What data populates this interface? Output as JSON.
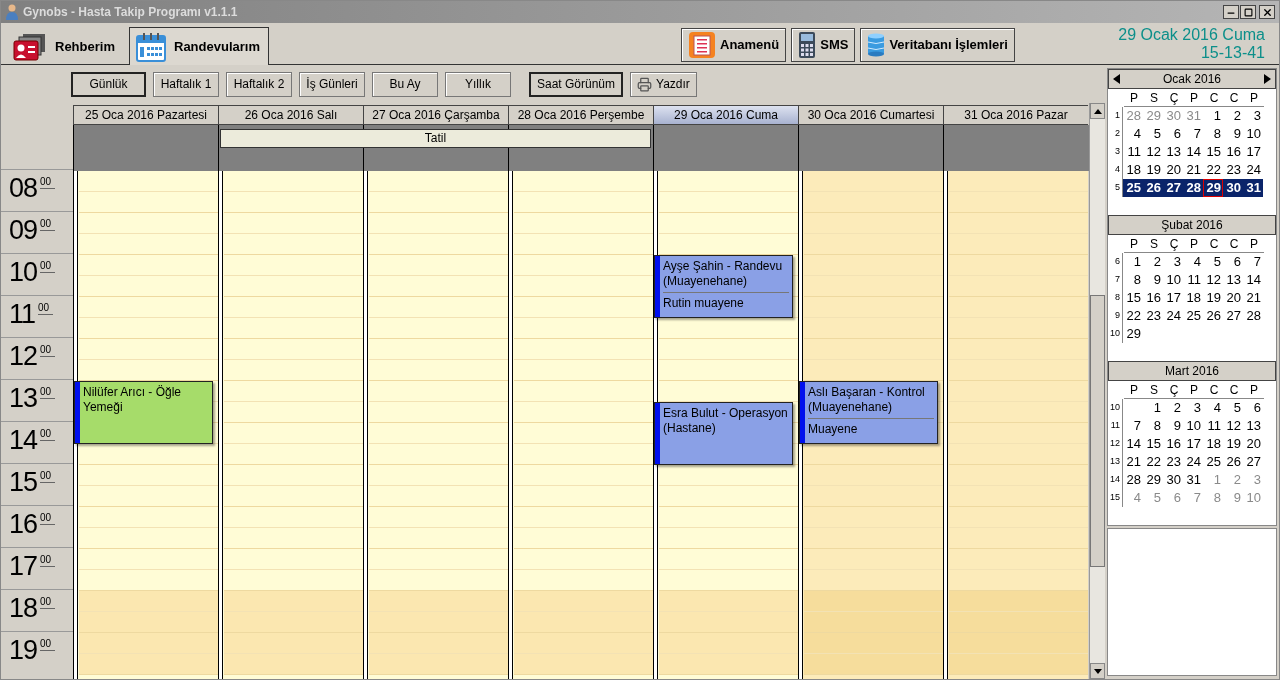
{
  "window": {
    "title": "Gynobs - Hasta Takip Programı v1.1.1"
  },
  "tabs": [
    {
      "label": "Rehberim",
      "selected": false,
      "kind": "contacts"
    },
    {
      "label": "Randevularım",
      "selected": true,
      "kind": "calendar"
    }
  ],
  "top_buttons": [
    {
      "label": "Anamenü",
      "kind": "menu"
    },
    {
      "label": "SMS",
      "kind": "phone"
    },
    {
      "label": "Veritabanı İşlemleri",
      "kind": "database"
    }
  ],
  "clock": {
    "date": "29 Ocak 2016 Cuma",
    "time": "15-13-41"
  },
  "toolbar": {
    "views": [
      {
        "label": "Günlük",
        "selected": true
      },
      {
        "label": "Haftalık 1",
        "selected": false
      },
      {
        "label": "Haftalık 2",
        "selected": false
      },
      {
        "label": "İş Günleri",
        "selected": false
      },
      {
        "label": "Bu Ay",
        "selected": false
      },
      {
        "label": "Yıllık",
        "selected": false
      }
    ],
    "tools": [
      {
        "label": "Saat Görünüm",
        "kind": "toggle"
      },
      {
        "label": "Yazdır",
        "kind": "print"
      }
    ]
  },
  "all_day": {
    "title": "Tatil"
  },
  "hours": [
    {
      "h": "08",
      "m": "00"
    },
    {
      "h": "09",
      "m": "00"
    },
    {
      "h": "10",
      "m": "00"
    },
    {
      "h": "11",
      "m": "00"
    },
    {
      "h": "12",
      "m": "00"
    },
    {
      "h": "13",
      "m": "00"
    },
    {
      "h": "14",
      "m": "00"
    },
    {
      "h": "15",
      "m": "00"
    },
    {
      "h": "16",
      "m": "00"
    },
    {
      "h": "17",
      "m": "00"
    },
    {
      "h": "18",
      "m": "00"
    },
    {
      "h": "19",
      "m": "00"
    }
  ],
  "days": [
    {
      "label": "25 Oca 2016 Pazartesi",
      "selected": false,
      "weekend": false,
      "holiday": false,
      "rows": [
        {
          "evening": false
        },
        {
          "evening": false
        },
        {
          "evening": false
        },
        {
          "evening": false
        },
        {
          "evening": false
        },
        {
          "evening": false,
          "events": [
            {
              "title": "Nilüfer Arıcı - Öğle Yemeği",
              "half_past": false,
              "color": "#a6dc6a"
            }
          ]
        },
        {
          "evening": false
        },
        {
          "evening": false
        },
        {
          "evening": false
        },
        {
          "evening": false
        },
        {
          "evening": true
        },
        {
          "evening": true
        }
      ]
    },
    {
      "label": "26 Oca 2016 Salı",
      "selected": false,
      "weekend": false,
      "holiday": true,
      "rows": [
        {
          "evening": false
        },
        {
          "evening": false
        },
        {
          "evening": false
        },
        {
          "evening": false
        },
        {
          "evening": false
        },
        {
          "evening": false
        },
        {
          "evening": false
        },
        {
          "evening": false
        },
        {
          "evening": false
        },
        {
          "evening": false
        },
        {
          "evening": true
        },
        {
          "evening": true
        }
      ]
    },
    {
      "label": "27 Oca 2016 Çarşamba",
      "selected": false,
      "weekend": false,
      "holiday": true,
      "rows": [
        {
          "evening": false
        },
        {
          "evening": false
        },
        {
          "evening": false
        },
        {
          "evening": false
        },
        {
          "evening": false
        },
        {
          "evening": false
        },
        {
          "evening": false
        },
        {
          "evening": false
        },
        {
          "evening": false
        },
        {
          "evening": false
        },
        {
          "evening": true
        },
        {
          "evening": true
        }
      ]
    },
    {
      "label": "28 Oca 2016 Perşembe",
      "selected": false,
      "weekend": false,
      "holiday": true,
      "rows": [
        {
          "evening": false
        },
        {
          "evening": false
        },
        {
          "evening": false
        },
        {
          "evening": false
        },
        {
          "evening": false
        },
        {
          "evening": false
        },
        {
          "evening": false
        },
        {
          "evening": false
        },
        {
          "evening": false
        },
        {
          "evening": false
        },
        {
          "evening": true
        },
        {
          "evening": true
        }
      ]
    },
    {
      "label": "29 Oca 2016 Cuma",
      "selected": true,
      "weekend": false,
      "holiday": false,
      "rows": [
        {
          "evening": false
        },
        {
          "evening": false
        },
        {
          "evening": false,
          "events": [
            {
              "title": "Ayşe Şahin - Randevu (Muayenehane)",
              "note": "Rutin muayene",
              "half_past": false,
              "color": "#8aa0e6"
            }
          ]
        },
        {
          "evening": false
        },
        {
          "evening": false
        },
        {
          "evening": false,
          "events": [
            {
              "title": "Esra Bulut - Operasyon (Hastane)",
              "half_past": true,
              "color": "#8aa0e6"
            }
          ]
        },
        {
          "evening": false
        },
        {
          "evening": false
        },
        {
          "evening": false
        },
        {
          "evening": false
        },
        {
          "evening": true
        },
        {
          "evening": true
        }
      ]
    },
    {
      "label": "30 Oca 2016 Cumartesi",
      "selected": false,
      "weekend": true,
      "holiday": false,
      "rows": [
        {
          "evening": false
        },
        {
          "evening": false
        },
        {
          "evening": false
        },
        {
          "evening": false
        },
        {
          "evening": false
        },
        {
          "evening": false,
          "events": [
            {
              "title": "Aslı Başaran - Kontrol (Muayenehane)",
              "note": "Muayene",
              "half_past": false,
              "color": "#8aa0e6"
            }
          ]
        },
        {
          "evening": false
        },
        {
          "evening": false
        },
        {
          "evening": false
        },
        {
          "evening": false
        },
        {
          "evening": true
        },
        {
          "evening": true
        }
      ]
    },
    {
      "label": "31 Oca 2016 Pazar",
      "selected": false,
      "weekend": true,
      "holiday": false,
      "rows": [
        {
          "evening": false
        },
        {
          "evening": false
        },
        {
          "evening": false
        },
        {
          "evening": false
        },
        {
          "evening": false
        },
        {
          "evening": false
        },
        {
          "evening": false
        },
        {
          "evening": false
        },
        {
          "evening": false
        },
        {
          "evening": false
        },
        {
          "evening": true
        },
        {
          "evening": true
        }
      ]
    }
  ],
  "mini_calendars": [
    {
      "title": "Ocak 2016",
      "arrows": true,
      "weekdays": [
        "P",
        "S",
        "Ç",
        "P",
        "C",
        "C",
        "P"
      ],
      "weeks": [
        {
          "no": "1",
          "selected": false,
          "days": [
            {
              "d": "28",
              "muted": true,
              "today": false
            },
            {
              "d": "29",
              "muted": true,
              "today": false
            },
            {
              "d": "30",
              "muted": true,
              "today": false
            },
            {
              "d": "31",
              "muted": true,
              "today": false
            },
            {
              "d": "1",
              "muted": false,
              "today": false
            },
            {
              "d": "2",
              "muted": false,
              "today": false
            },
            {
              "d": "3",
              "muted": false,
              "today": false
            }
          ]
        },
        {
          "no": "2",
          "selected": false,
          "days": [
            {
              "d": "4",
              "muted": false,
              "today": false
            },
            {
              "d": "5",
              "muted": false,
              "today": false
            },
            {
              "d": "6",
              "muted": false,
              "today": false
            },
            {
              "d": "7",
              "muted": false,
              "today": false
            },
            {
              "d": "8",
              "muted": false,
              "today": false
            },
            {
              "d": "9",
              "muted": false,
              "today": false
            },
            {
              "d": "10",
              "muted": false,
              "today": false
            }
          ]
        },
        {
          "no": "3",
          "selected": false,
          "days": [
            {
              "d": "11",
              "muted": false,
              "today": false
            },
            {
              "d": "12",
              "muted": false,
              "today": false
            },
            {
              "d": "13",
              "muted": false,
              "today": false
            },
            {
              "d": "14",
              "muted": false,
              "today": false
            },
            {
              "d": "15",
              "muted": false,
              "today": false
            },
            {
              "d": "16",
              "muted": false,
              "today": false
            },
            {
              "d": "17",
              "muted": false,
              "today": false
            }
          ]
        },
        {
          "no": "4",
          "selected": false,
          "days": [
            {
              "d": "18",
              "muted": false,
              "today": false
            },
            {
              "d": "19",
              "muted": false,
              "today": false
            },
            {
              "d": "20",
              "muted": false,
              "today": false
            },
            {
              "d": "21",
              "muted": false,
              "today": false
            },
            {
              "d": "22",
              "muted": false,
              "today": false
            },
            {
              "d": "23",
              "muted": false,
              "today": false
            },
            {
              "d": "24",
              "muted": false,
              "today": false
            }
          ]
        },
        {
          "no": "5",
          "selected": true,
          "days": [
            {
              "d": "25",
              "muted": false,
              "today": false
            },
            {
              "d": "26",
              "muted": false,
              "today": false
            },
            {
              "d": "27",
              "muted": false,
              "today": false
            },
            {
              "d": "28",
              "muted": false,
              "today": false
            },
            {
              "d": "29",
              "muted": false,
              "today": true
            },
            {
              "d": "30",
              "muted": false,
              "today": false
            },
            {
              "d": "31",
              "muted": false,
              "today": false
            }
          ]
        }
      ]
    },
    {
      "title": "Şubat 2016",
      "arrows": false,
      "weekdays": [
        "P",
        "S",
        "Ç",
        "P",
        "C",
        "C",
        "P"
      ],
      "weeks": [
        {
          "no": "6",
          "selected": false,
          "days": [
            {
              "d": "1",
              "muted": false,
              "today": false
            },
            {
              "d": "2",
              "muted": false,
              "today": false
            },
            {
              "d": "3",
              "muted": false,
              "today": false
            },
            {
              "d": "4",
              "muted": false,
              "today": false
            },
            {
              "d": "5",
              "muted": false,
              "today": false
            },
            {
              "d": "6",
              "muted": false,
              "today": false
            },
            {
              "d": "7",
              "muted": false,
              "today": false
            }
          ]
        },
        {
          "no": "7",
          "selected": false,
          "days": [
            {
              "d": "8",
              "muted": false,
              "today": false
            },
            {
              "d": "9",
              "muted": false,
              "today": false
            },
            {
              "d": "10",
              "muted": false,
              "today": false
            },
            {
              "d": "11",
              "muted": false,
              "today": false
            },
            {
              "d": "12",
              "muted": false,
              "today": false
            },
            {
              "d": "13",
              "muted": false,
              "today": false
            },
            {
              "d": "14",
              "muted": false,
              "today": false
            }
          ]
        },
        {
          "no": "8",
          "selected": false,
          "days": [
            {
              "d": "15",
              "muted": false,
              "today": false
            },
            {
              "d": "16",
              "muted": false,
              "today": false
            },
            {
              "d": "17",
              "muted": false,
              "today": false
            },
            {
              "d": "18",
              "muted": false,
              "today": false
            },
            {
              "d": "19",
              "muted": false,
              "today": false
            },
            {
              "d": "20",
              "muted": false,
              "today": false
            },
            {
              "d": "21",
              "muted": false,
              "today": false
            }
          ]
        },
        {
          "no": "9",
          "selected": false,
          "days": [
            {
              "d": "22",
              "muted": false,
              "today": false
            },
            {
              "d": "23",
              "muted": false,
              "today": false
            },
            {
              "d": "24",
              "muted": false,
              "today": false
            },
            {
              "d": "25",
              "muted": false,
              "today": false
            },
            {
              "d": "26",
              "muted": false,
              "today": false
            },
            {
              "d": "27",
              "muted": false,
              "today": false
            },
            {
              "d": "28",
              "muted": false,
              "today": false
            }
          ]
        },
        {
          "no": "10",
          "selected": false,
          "days": [
            {
              "d": "29",
              "muted": false,
              "today": false
            }
          ]
        }
      ]
    },
    {
      "title": "Mart 2016",
      "arrows": false,
      "weekdays": [
        "P",
        "S",
        "Ç",
        "P",
        "C",
        "C",
        "P"
      ],
      "weeks": [
        {
          "no": "10",
          "selected": false,
          "leading_blank": true,
          "days": [
            {
              "d": "1",
              "muted": false,
              "today": false
            },
            {
              "d": "2",
              "muted": false,
              "today": false
            },
            {
              "d": "3",
              "muted": false,
              "today": false
            },
            {
              "d": "4",
              "muted": false,
              "today": false
            },
            {
              "d": "5",
              "muted": false,
              "today": false
            },
            {
              "d": "6",
              "muted": false,
              "today": false
            }
          ]
        },
        {
          "no": "11",
          "selected": false,
          "leading_blank": false,
          "days": [
            {
              "d": "7",
              "muted": false,
              "today": false
            },
            {
              "d": "8",
              "muted": false,
              "today": false
            },
            {
              "d": "9",
              "muted": false,
              "today": false
            },
            {
              "d": "10",
              "muted": false,
              "today": false
            },
            {
              "d": "11",
              "muted": false,
              "today": false
            },
            {
              "d": "12",
              "muted": false,
              "today": false
            },
            {
              "d": "13",
              "muted": false,
              "today": false
            }
          ]
        },
        {
          "no": "12",
          "selected": false,
          "leading_blank": false,
          "days": [
            {
              "d": "14",
              "muted": false,
              "today": false
            },
            {
              "d": "15",
              "muted": false,
              "today": false
            },
            {
              "d": "16",
              "muted": false,
              "today": false
            },
            {
              "d": "17",
              "muted": false,
              "today": false
            },
            {
              "d": "18",
              "muted": false,
              "today": false
            },
            {
              "d": "19",
              "muted": false,
              "today": false
            },
            {
              "d": "20",
              "muted": false,
              "today": false
            }
          ]
        },
        {
          "no": "13",
          "selected": false,
          "leading_blank": false,
          "days": [
            {
              "d": "21",
              "muted": false,
              "today": false
            },
            {
              "d": "22",
              "muted": false,
              "today": false
            },
            {
              "d": "23",
              "muted": false,
              "today": false
            },
            {
              "d": "24",
              "muted": false,
              "today": false
            },
            {
              "d": "25",
              "muted": false,
              "today": false
            },
            {
              "d": "26",
              "muted": false,
              "today": false
            },
            {
              "d": "27",
              "muted": false,
              "today": false
            }
          ]
        },
        {
          "no": "14",
          "selected": false,
          "leading_blank": false,
          "days": [
            {
              "d": "28",
              "muted": false,
              "today": false
            },
            {
              "d": "29",
              "muted": false,
              "today": false
            },
            {
              "d": "30",
              "muted": false,
              "today": false
            },
            {
              "d": "31",
              "muted": false,
              "today": false
            },
            {
              "d": "1",
              "muted": true,
              "today": false
            },
            {
              "d": "2",
              "muted": true,
              "today": false
            },
            {
              "d": "3",
              "muted": true,
              "today": false
            }
          ]
        },
        {
          "no": "15",
          "selected": false,
          "leading_blank": false,
          "days": [
            {
              "d": "4",
              "muted": true,
              "today": false
            },
            {
              "d": "5",
              "muted": true,
              "today": false
            },
            {
              "d": "6",
              "muted": true,
              "today": false
            },
            {
              "d": "7",
              "muted": true,
              "today": false
            },
            {
              "d": "8",
              "muted": true,
              "today": false
            },
            {
              "d": "9",
              "muted": true,
              "today": false
            },
            {
              "d": "10",
              "muted": true,
              "today": false
            }
          ]
        }
      ]
    }
  ]
}
